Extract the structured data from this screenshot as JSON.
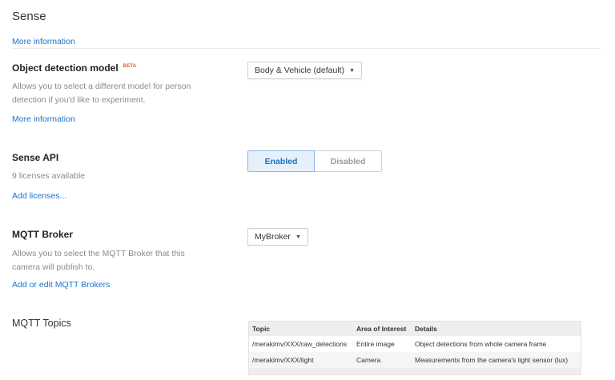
{
  "sense": {
    "title": "Sense",
    "more_info": "More information"
  },
  "object_detection": {
    "title": "Object detection model",
    "beta": "BETA",
    "description_line1": "Allows you to select a different model for person",
    "description_line2": "detection if you'd like to experiment.",
    "more_info": "More information",
    "selected": "Body & Vehicle (default)"
  },
  "sense_api": {
    "title": "Sense API",
    "licenses": "9 licenses available",
    "add_licenses": "Add licenses...",
    "enabled_label": "Enabled",
    "disabled_label": "Disabled",
    "selected": "Enabled"
  },
  "mqtt_broker": {
    "title": "MQTT Broker",
    "description_line1": "Allows you to select the MQTT Broker that this",
    "description_line2": "camera will publish to.",
    "edit_link": "Add or edit MQTT Brokers",
    "selected": "MyBroker"
  },
  "mqtt_topics": {
    "title": "MQTT Topics",
    "headers": [
      "Topic",
      "Area of Interest",
      "Details"
    ],
    "rows": [
      [
        "/merakimv/XXX/raw_detections",
        "Entire image",
        "Object detections from whole camera frame"
      ],
      [
        "/merakimv/XXX/light",
        "Camera",
        "Measurements from the camera's light sensor (lux)"
      ]
    ]
  },
  "icons": {
    "dropdown_caret": "caret-down-icon"
  }
}
